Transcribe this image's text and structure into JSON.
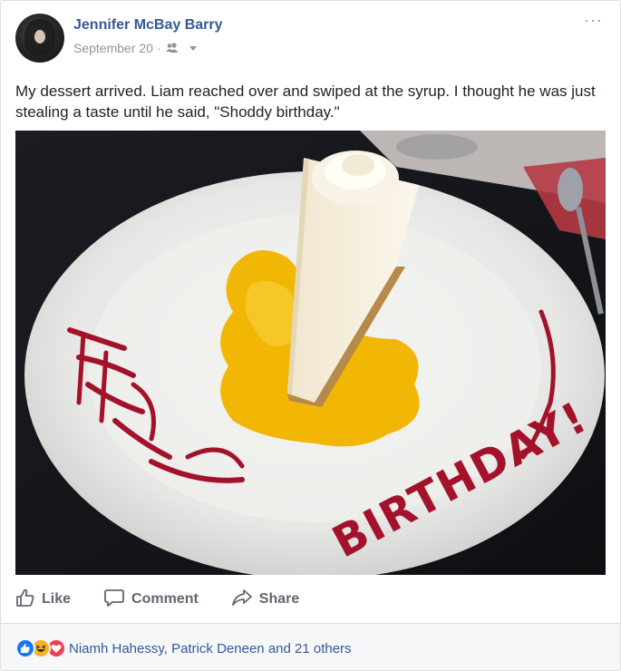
{
  "post": {
    "author": "Jennifer McBay Barry",
    "date": "September 20",
    "date_separator": "·",
    "audience_icon": "friends-icon",
    "more_label": "···",
    "message": "My dessert arrived. Liam reached over and swiped at the syrup. I thought he was just stealing a taste until he said, \"Shoddy birthday.\"",
    "photo_text": "BIRTHDAY!"
  },
  "actions": {
    "like": "Like",
    "comment": "Comment",
    "share": "Share"
  },
  "reactions": {
    "icons": [
      "like-reaction-icon",
      "haha-reaction-icon",
      "love-reaction-icon"
    ],
    "summary": "Niamh Hahessy, Patrick Deneen and 21 others"
  },
  "colors": {
    "link": "#365899",
    "muted": "#90949c",
    "action": "#606770",
    "like_blue": "#1877f2",
    "love_red": "#f33e58",
    "haha_yellow": "#f7b125"
  }
}
